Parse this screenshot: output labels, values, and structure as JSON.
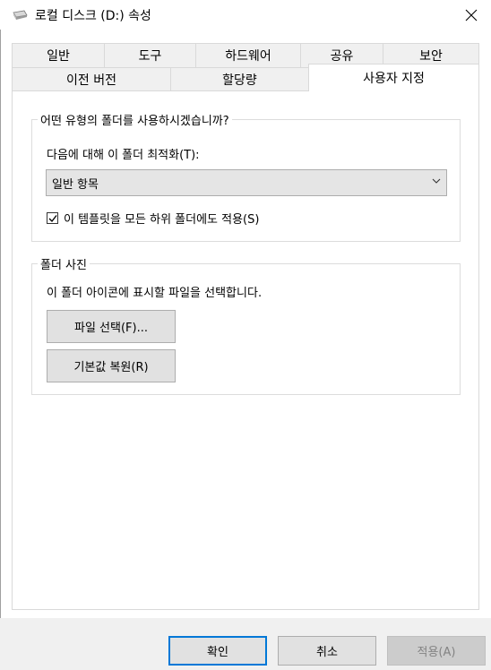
{
  "window": {
    "title": "로컬 디스크 (D:) 속성",
    "icon": "drive-icon",
    "close_icon": "close-icon"
  },
  "tabs": {
    "row1": [
      "일반",
      "도구",
      "하드웨어",
      "공유",
      "보안"
    ],
    "row2": [
      "이전 버전",
      "할당량",
      "사용자 지정"
    ],
    "active": "사용자 지정"
  },
  "optimize_group": {
    "title": "어떤 유형의 폴더를 사용하시겠습니까?",
    "label": "다음에 대해 이 폴더 최적화(T):",
    "combo_value": "일반 항목",
    "checkbox_label": "이 템플릿을 모든 하위 폴더에도 적용(S)",
    "checkbox_checked": true
  },
  "picture_group": {
    "title": "폴더 사진",
    "description": "이 폴더 아이콘에 표시할 파일을 선택합니다.",
    "choose_file_button": "파일 선택(F)...",
    "restore_default_button": "기본값 복원(R)"
  },
  "footer": {
    "ok": "확인",
    "cancel": "취소",
    "apply": "적용(A)"
  },
  "colors": {
    "accent": "#0078d7",
    "button_bg": "#e1e1e1",
    "tab_bg": "#f0f0f0"
  }
}
